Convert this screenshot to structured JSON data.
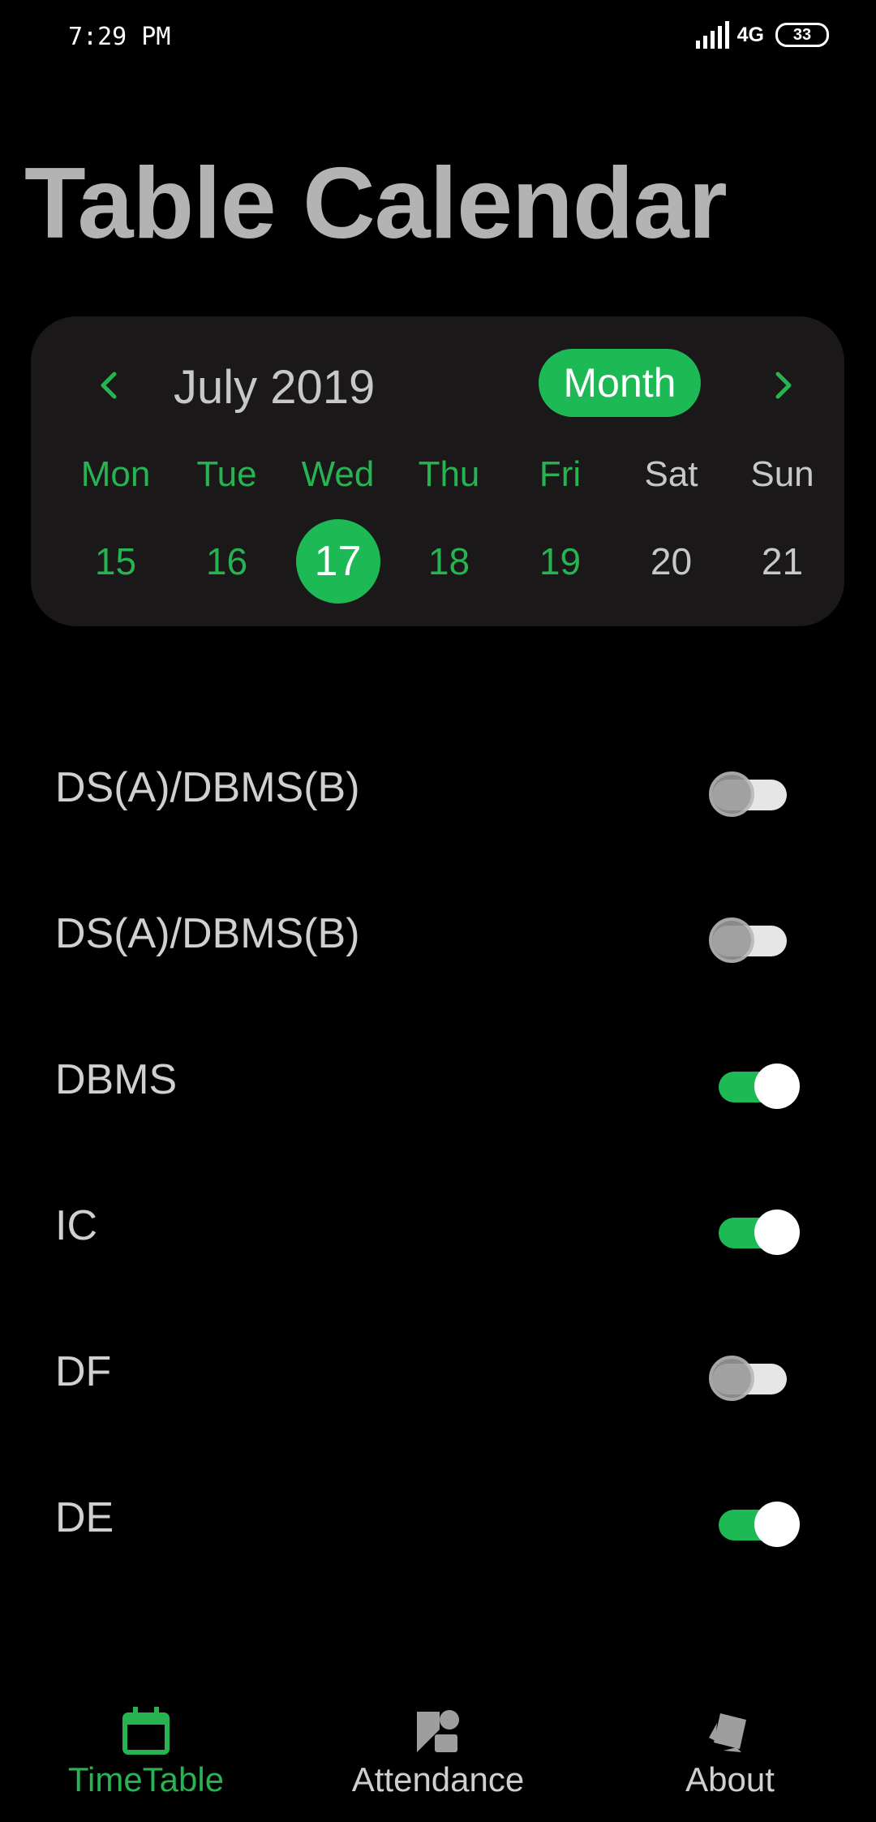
{
  "status_bar": {
    "time": "7:29 PM",
    "network": "4G",
    "battery": "33"
  },
  "title": "Table Calendar",
  "calendar": {
    "month_label": "July 2019",
    "format_button": "Month",
    "prev_icon": "chevron-left-icon",
    "next_icon": "chevron-right-icon",
    "weekdays": [
      "Mon",
      "Tue",
      "Wed",
      "Thu",
      "Fri",
      "Sat",
      "Sun"
    ],
    "days": [
      "15",
      "16",
      "17",
      "18",
      "19",
      "20",
      "21"
    ],
    "selected_day": "17",
    "accent_color": "#1db954"
  },
  "subjects": [
    {
      "label": "DS(A)/DBMS(B)",
      "enabled": false
    },
    {
      "label": "DS(A)/DBMS(B)",
      "enabled": false
    },
    {
      "label": "DBMS",
      "enabled": true
    },
    {
      "label": "IC",
      "enabled": true
    },
    {
      "label": "DF",
      "enabled": false
    },
    {
      "label": "DE",
      "enabled": true
    }
  ],
  "bottom_nav": {
    "items": [
      {
        "label": "TimeTable",
        "icon": "calendar-icon",
        "active": true
      },
      {
        "label": "Attendance",
        "icon": "attendance-icon",
        "active": false
      },
      {
        "label": "About",
        "icon": "about-icon",
        "active": false
      }
    ]
  }
}
